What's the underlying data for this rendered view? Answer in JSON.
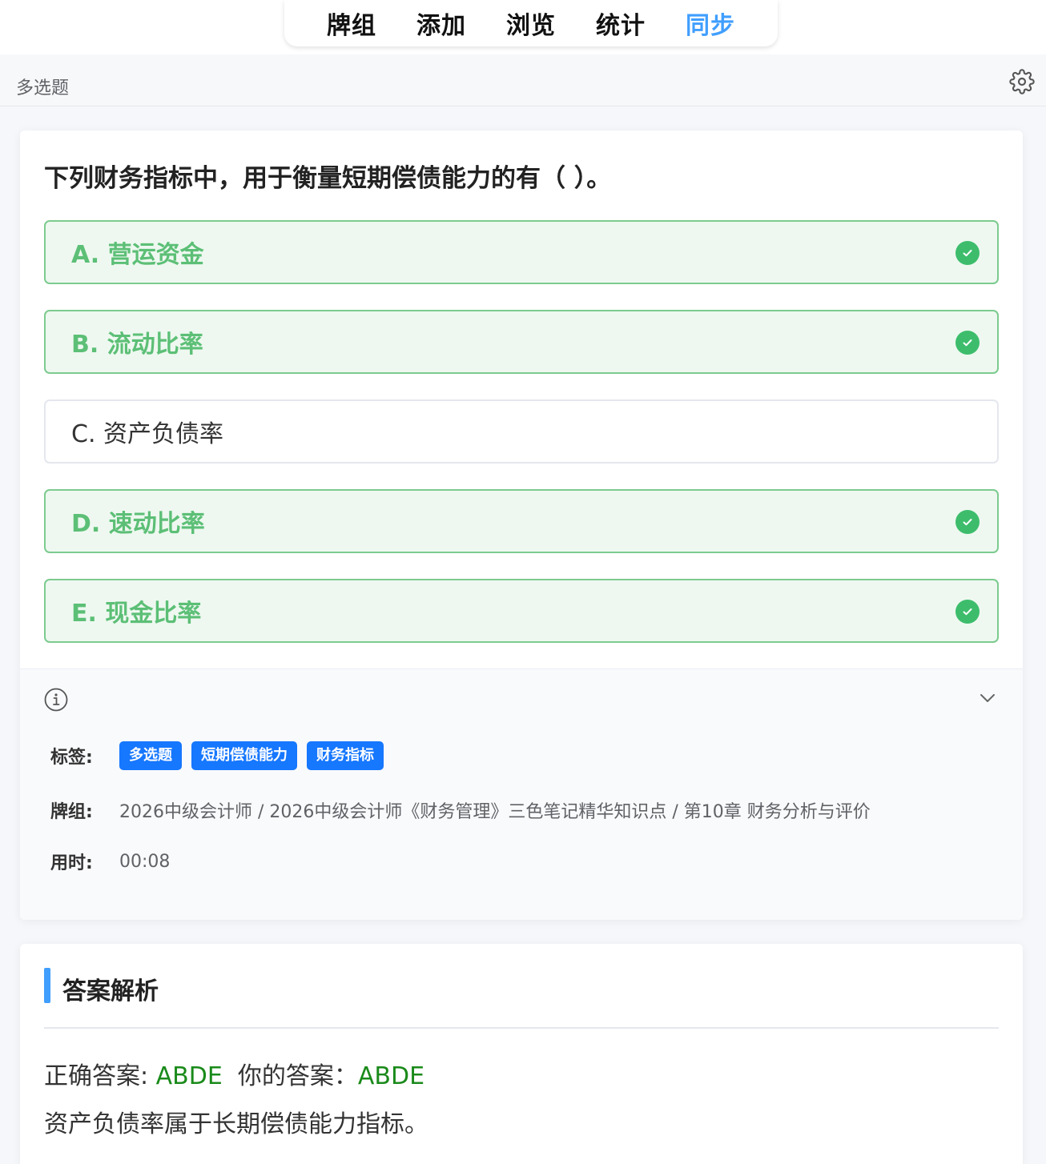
{
  "nav": {
    "items": [
      "牌组",
      "添加",
      "浏览",
      "统计",
      "同步"
    ],
    "active_index": 4
  },
  "header": {
    "type_label": "多选题"
  },
  "question": {
    "text": "下列财务指标中，用于衡量短期偿债能力的有（ ）。",
    "options": [
      {
        "label": "A. 营运资金",
        "correct": true
      },
      {
        "label": "B. 流动比率",
        "correct": true
      },
      {
        "label": "C. 资产负债率",
        "correct": false
      },
      {
        "label": "D. 速动比率",
        "correct": true
      },
      {
        "label": "E. 现金比率",
        "correct": true
      }
    ]
  },
  "meta": {
    "tags_label": "标签:",
    "tags": [
      "多选题",
      "短期偿债能力",
      "财务指标"
    ],
    "deck_label": "牌组:",
    "deck_value": "2026中级会计师 / 2026中级会计师《财务管理》三色笔记精华知识点 / 第10章 财务分析与评价",
    "time_label": "用时:",
    "time_value": "00:08"
  },
  "analysis": {
    "title": "答案解析",
    "correct_label": "正确答案: ",
    "correct_value": "ABDE",
    "yours_label": "你的答案：",
    "yours_value": "ABDE",
    "explanation": "资产负债率属于长期偿债能力指标。"
  },
  "colors": {
    "accent": "#409eff",
    "correct_green": "#3dbd6c",
    "tag_blue": "#1677ff"
  }
}
